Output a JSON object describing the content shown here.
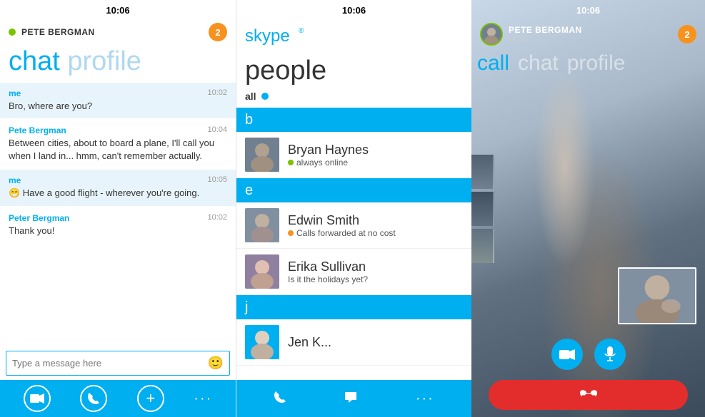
{
  "panel1": {
    "status_bar_time": "10:06",
    "contact_name": "PETE BERGMAN",
    "badge_count": "2",
    "title_accent": "chat",
    "title_light": "profile",
    "messages": [
      {
        "sender": "me",
        "time": "10:02",
        "text": "Bro, where are you?",
        "is_me": true
      },
      {
        "sender": "Pete Bergman",
        "time": "10:04",
        "text": "Between cities, about to board a plane, I'll call you when I land in... hmm, can't remember actually.",
        "is_me": false
      },
      {
        "sender": "me",
        "time": "10:05",
        "text": "😁 Have a good flight - wherever you're going.",
        "is_me": true
      },
      {
        "sender": "Peter Bergman",
        "time": "10:02",
        "text": "Thank you!",
        "is_me": false
      }
    ],
    "input_placeholder": "Type a message here",
    "nav_icons": [
      "video",
      "phone",
      "add",
      "dots"
    ]
  },
  "panel2": {
    "status_bar_time": "10:06",
    "skype_logo": "skype",
    "title": "people",
    "filter_label": "all",
    "contacts": [
      {
        "letter": "b",
        "name": "Bryan Haynes",
        "status": "always online",
        "status_color": "green"
      },
      {
        "letter": "e",
        "name": "Edwin Smith",
        "status": "Calls forwarded at no cost",
        "status_color": "orange"
      },
      {
        "letter": "",
        "name": "Erika Sullivan",
        "status": "Is it the holidays yet?",
        "status_color": null
      },
      {
        "letter": "j",
        "name": "Jen K...",
        "status": "",
        "status_color": null
      }
    ],
    "nav_icons": [
      "phone",
      "chat"
    ]
  },
  "panel3": {
    "status_bar_time": "10:06",
    "contact_name": "PETE BERGMAN",
    "call_duration": "02:51",
    "badge_count": "2",
    "tab_call": "call",
    "tab_chat": "chat",
    "tab_profile": "profile",
    "action_icons": [
      "video",
      "mic"
    ],
    "end_call_icon": "phone-end"
  }
}
